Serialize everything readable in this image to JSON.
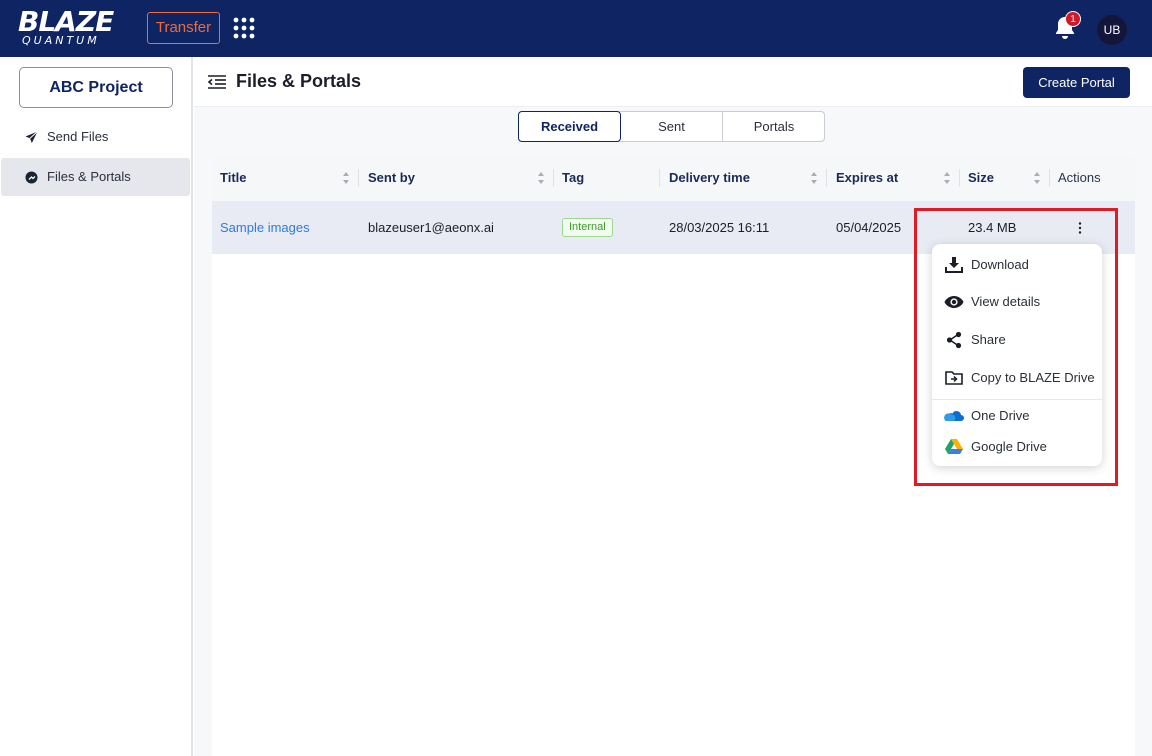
{
  "app": {
    "logo_main": "BLAZE",
    "logo_sub": "QUANTUM",
    "product_button": "Transfer",
    "notification_count": "1",
    "user_initials": "UB"
  },
  "sidebar": {
    "project_label": "ABC Project",
    "items": [
      {
        "label": "Send Files",
        "icon": "send-icon",
        "active": false
      },
      {
        "label": "Files & Portals",
        "icon": "portal-icon",
        "active": true
      }
    ]
  },
  "header": {
    "title": "Files & Portals",
    "create_button": "Create Portal"
  },
  "tabs": [
    {
      "label": "Received",
      "active": true
    },
    {
      "label": "Sent",
      "active": false
    },
    {
      "label": "Portals",
      "active": false
    }
  ],
  "table": {
    "columns": [
      "Title",
      "Sent by",
      "Tag",
      "Delivery time",
      "Expires at",
      "Size",
      "Actions"
    ],
    "rows": [
      {
        "title": "Sample images",
        "sent_by": "blazeuser1@aeonx.ai",
        "tag": "Internal",
        "delivery_time": "28/03/2025 16:11",
        "expires_at": "05/04/2025",
        "size": "23.4 MB"
      }
    ]
  },
  "action_menu": {
    "items": [
      {
        "label": "Download",
        "icon": "download-icon"
      },
      {
        "label": "View details",
        "icon": "eye-icon"
      },
      {
        "label": "Share",
        "icon": "share-icon"
      },
      {
        "label": "Copy to BLAZE Drive",
        "icon": "folder-copy-icon"
      },
      {
        "label": "One Drive",
        "icon": "onedrive-icon"
      },
      {
        "label": "Google Drive",
        "icon": "google-drive-icon"
      }
    ]
  },
  "colors": {
    "brand_navy": "#0f2563",
    "accent_orange": "#ef6b3a",
    "link_blue": "#2f7be0",
    "highlight_red": "#e01b24",
    "tag_green": "#3c9c2a"
  }
}
